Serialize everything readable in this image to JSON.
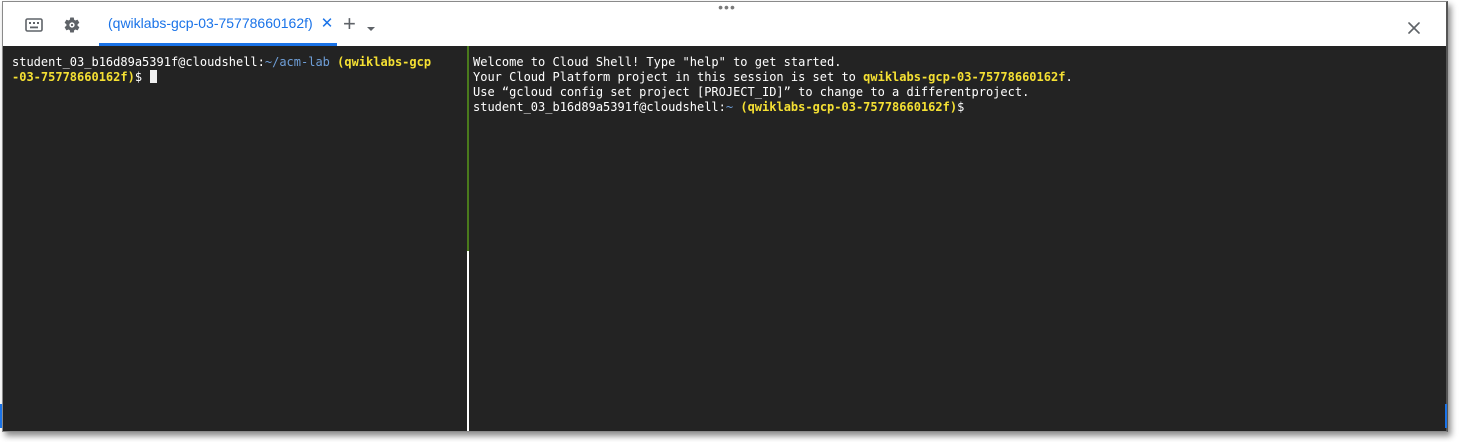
{
  "topbar": {
    "keyboard_icon": "keyboard-icon",
    "settings_icon": "gear-icon",
    "tab_label": "(qwiklabs-gcp-03-75778660162f)",
    "tab_close": "✕",
    "add_tab": "+",
    "close_panel": "✕"
  },
  "terminal_left": {
    "user_host": "student_03_b16d89a5391f@cloudshell:",
    "path": "~/acm-lab",
    "project_part1": "(qwiklabs-gcp",
    "project_part2": "-03-75778660162f)",
    "prompt_suffix": "$"
  },
  "terminal_right": {
    "welcome_line": "Welcome to Cloud Shell! Type \"help\" to get started.",
    "project_prefix": "Your Cloud Platform project in this session is set to ",
    "project_id": "qwiklabs-gcp-03-75778660162f",
    "project_suffix": ".",
    "hint_line": "Use “gcloud config set project [PROJECT_ID]” to change to a differentproject.",
    "user_host": "student_03_b16d89a5391f@cloudshell:",
    "path": "~",
    "project": "(qwiklabs-gcp-03-75778660162f)",
    "prompt_suffix": "$"
  },
  "colors": {
    "accent": "#1a73e8",
    "terminal_bg": "#232323",
    "project_yellow": "#f5e033",
    "path_blue": "#6f9fd8"
  }
}
